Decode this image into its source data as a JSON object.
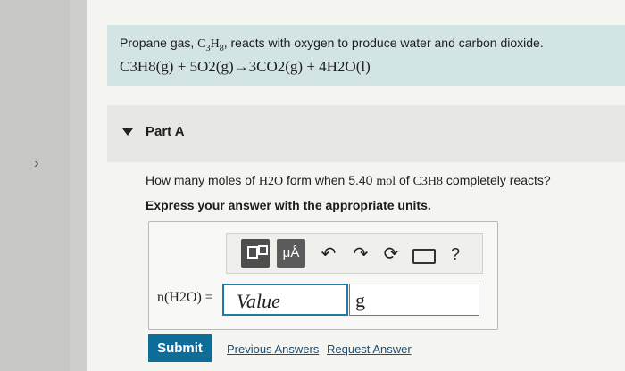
{
  "problem": {
    "intro_before_formula": "Propane gas, ",
    "intro_formula_base": "C",
    "intro_formula_sub1": "3",
    "intro_formula_mid": "H",
    "intro_formula_sub2": "8",
    "intro_after_formula": ", reacts with oxygen to produce water and carbon dioxide.",
    "equation": "C3H8(g) + 5O2(g)→3CO2(g) + 4H2O(l)"
  },
  "part": {
    "label": "Part A"
  },
  "question": {
    "text_before": "How many moles of ",
    "water": "H2O",
    "text_mid": " form when 5.40 ",
    "unit": "mol",
    "text_of": " of ",
    "propane": "C3H8",
    "text_after": " completely reacts?"
  },
  "instruction": "Express your answer with the appropriate units.",
  "toolbar": {
    "button1_icon": "template-icon",
    "button2_label": "μÅ",
    "undo_icon": "undo-icon",
    "redo_icon": "redo-icon",
    "reset_icon": "reset-icon",
    "keyboard_icon": "keyboard-icon",
    "help_label": "?"
  },
  "answer": {
    "label": "n(H2O) =",
    "value_placeholder": "Value",
    "unit_value": "g"
  },
  "actions": {
    "submit_label": "Submit",
    "previous_answers_label": "Previous Answers",
    "request_answer_label": "Request Answer"
  },
  "colors": {
    "problem_bg": "#d2e4e3",
    "submit_bg": "#0f6d99",
    "link": "#1a4d78",
    "input_border": "#1f7aa6"
  }
}
